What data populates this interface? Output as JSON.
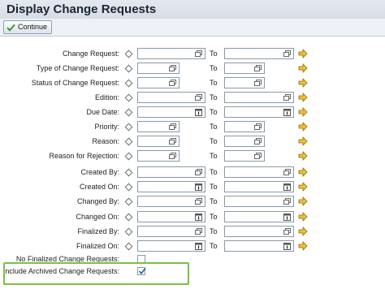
{
  "header": {
    "title": "Display Change Requests"
  },
  "toolbar": {
    "continue_label": "Continue"
  },
  "range_to_label": "To",
  "fields": [
    {
      "label": "Change Request:",
      "type": "help"
    },
    {
      "label": "Type of Change Request:",
      "type": "help"
    },
    {
      "label": "Status of Change Request:",
      "type": "help"
    },
    {
      "label": "Edition:",
      "type": "help"
    },
    {
      "label": "Due Date:",
      "type": "calendar"
    },
    {
      "label": "Priority:",
      "type": "help"
    },
    {
      "label": "Reason:",
      "type": "help"
    },
    {
      "label": "Reason for Rejection:",
      "type": "help"
    },
    {
      "label": "Created By:",
      "type": "help"
    },
    {
      "label": "Created On:",
      "type": "calendar"
    },
    {
      "label": "Changed By:",
      "type": "help"
    },
    {
      "label": "Changed On:",
      "type": "calendar"
    },
    {
      "label": "Finalized By:",
      "type": "help"
    },
    {
      "label": "Finalized On:",
      "type": "calendar"
    }
  ],
  "options": [
    {
      "label": "No Finalized Change Requests:",
      "checked": false
    },
    {
      "label": "Include Archived Change Requests:",
      "checked": true
    }
  ],
  "colors": {
    "highlight_border": "#7cbf45",
    "arrow_fill": "#f2c12e",
    "check_color": "#1f5fa8"
  }
}
